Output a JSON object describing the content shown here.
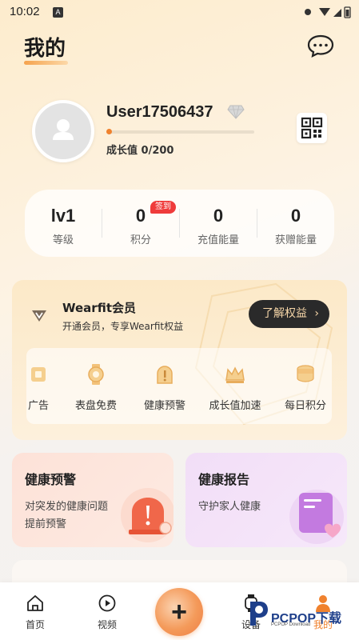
{
  "status_bar": {
    "time": "10:02",
    "notification_glyph": "A"
  },
  "header": {
    "title": "我的"
  },
  "profile": {
    "username": "User17506437",
    "growth_label": "成长值 0/200",
    "growth_progress": 0
  },
  "stats": [
    {
      "value": "lv1",
      "label": "等级"
    },
    {
      "value": "0",
      "label": "积分",
      "badge": "签到"
    },
    {
      "value": "0",
      "label": "充值能量"
    },
    {
      "value": "0",
      "label": "获赠能量"
    }
  ],
  "vip": {
    "title": "Wearfit会员",
    "subtitle": "开通会员，专享Wearfit权益",
    "button_label": "了解权益",
    "button_arrow": "›",
    "benefits": [
      {
        "label": "广告",
        "icon": "ad-free-icon"
      },
      {
        "label": "表盘免费",
        "icon": "watch-face-icon"
      },
      {
        "label": "健康预警",
        "icon": "warning-icon"
      },
      {
        "label": "成长值加速",
        "icon": "crown-icon"
      },
      {
        "label": "每日积分",
        "icon": "coin-stack-icon"
      }
    ]
  },
  "cards": {
    "health_alert": {
      "title": "健康预警",
      "desc_line1": "对突发的健康问题",
      "desc_line2": "提前预警"
    },
    "health_report": {
      "title": "健康报告",
      "desc": "守护家人健康"
    }
  },
  "tabbar": {
    "items": [
      {
        "label": "首页",
        "icon": "home-icon"
      },
      {
        "label": "视频",
        "icon": "play-icon"
      },
      {
        "label": "设备",
        "icon": "watch-icon"
      },
      {
        "label": "我的",
        "icon": "person-icon",
        "active": true
      }
    ],
    "center_glyph": "+"
  },
  "watermark": {
    "text": "PCPOP下载",
    "subtext": "PCPOP Download"
  },
  "colors": {
    "accent": "#f0822e",
    "badge": "#ef3b3b",
    "vip_button": "#2a2a2a"
  }
}
